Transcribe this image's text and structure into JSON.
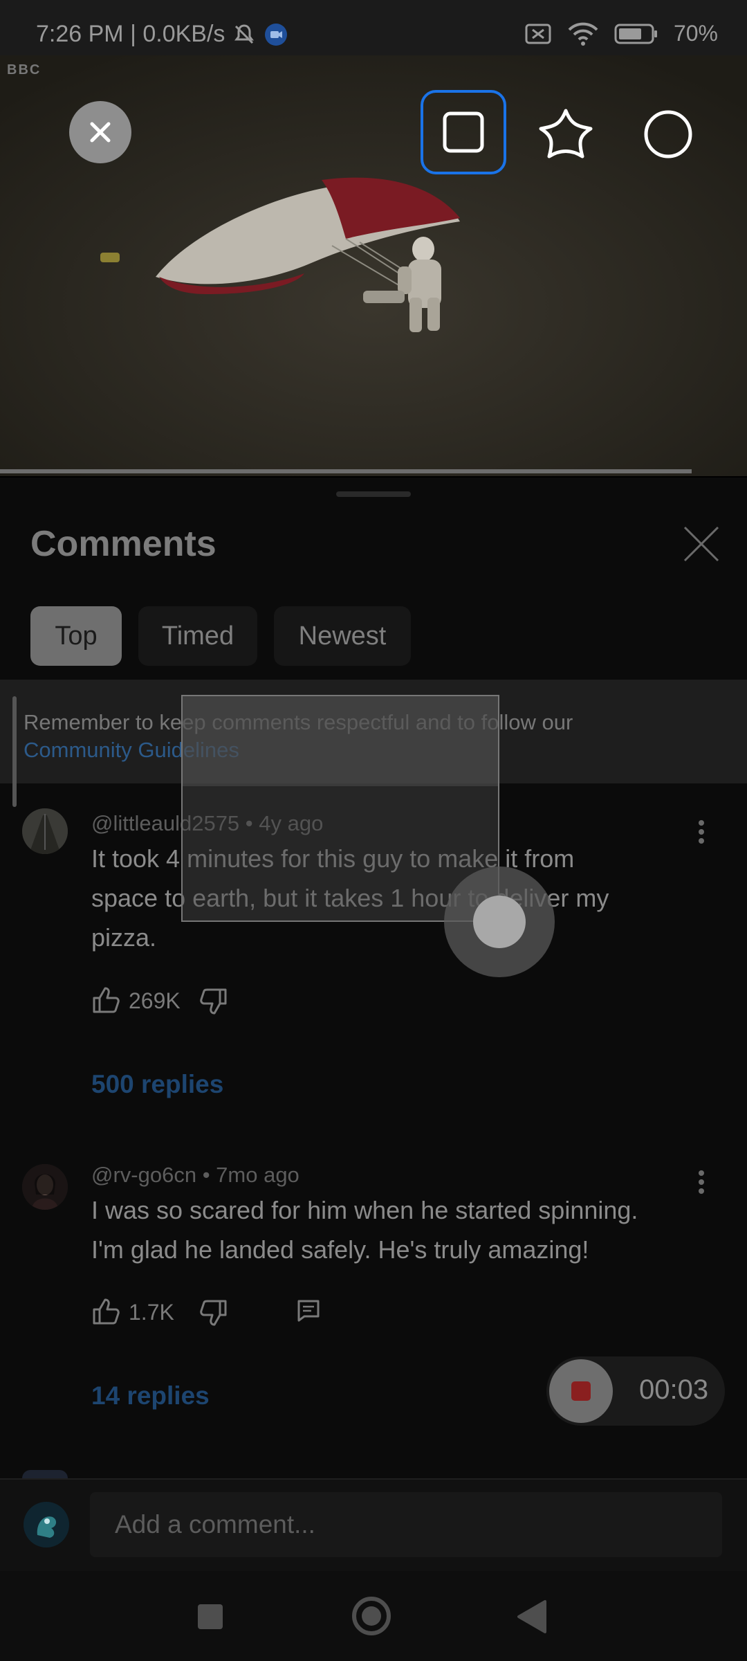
{
  "status_bar": {
    "time": "7:26 PM | 0.0KB/s",
    "battery": "70%"
  },
  "video": {
    "watermark": "BBC"
  },
  "recorder_toolbar": {
    "close_icon": "close-icon",
    "shapes": [
      "square-icon",
      "star-blob-icon",
      "circle-icon"
    ]
  },
  "comments": {
    "title": "Comments",
    "filters": [
      "Top",
      "Timed",
      "Newest"
    ],
    "notice": "Remember to keep comments respectful and to follow our",
    "notice_link": "Community Guidelines",
    "items": [
      {
        "author": "@littleauld2575",
        "age": "4y ago",
        "meta": "@littleauld2575 • 4y ago",
        "text_lines": [
          "It took 4 minutes for this guy to make it from",
          "space to earth, but it takes 1 hour to deliver my",
          "pizza."
        ],
        "likes": "269K",
        "replies": "500 replies"
      },
      {
        "author": "@rv-go6cn",
        "age": "7mo ago",
        "meta": "@rv-go6cn • 7mo ago",
        "text_lines": [
          "I was so scared for him when he started spinning.",
          "I'm glad he landed safely. He's truly amazing!"
        ],
        "likes": "1.7K",
        "replies": "14 replies"
      }
    ]
  },
  "composer": {
    "placeholder": "Add a comment..."
  },
  "recording": {
    "elapsed": "00:03"
  }
}
